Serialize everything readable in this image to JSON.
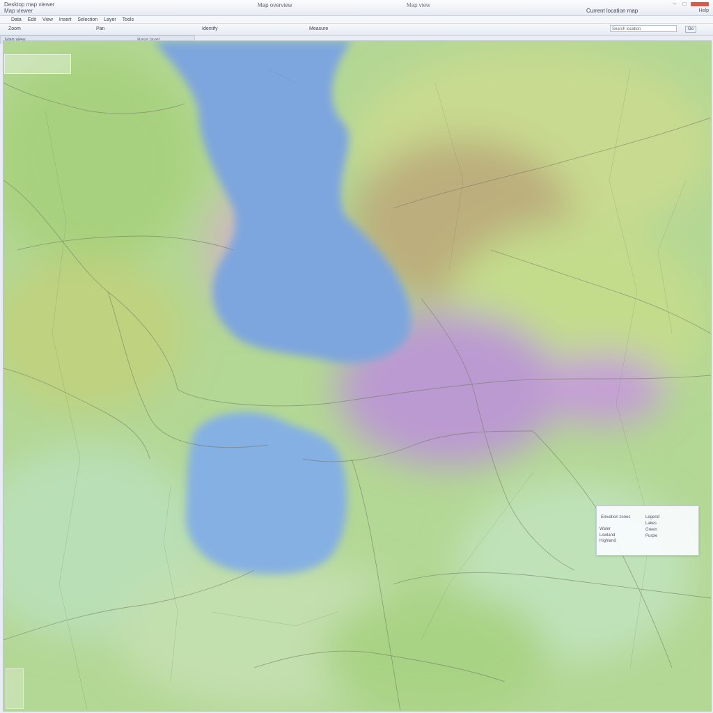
{
  "window": {
    "app_title": "Desktop map viewer",
    "subtitle": "Map viewer",
    "document_title": "Map overview",
    "center_label": "Map view",
    "account_label": "Current location map"
  },
  "menu": {
    "items": [
      "Data",
      "Edit",
      "View",
      "Insert",
      "Selection",
      "Layer",
      "Tools"
    ],
    "right_label": "Help"
  },
  "toolbar": {
    "items": [
      "Zoom",
      "Pan",
      "Identify",
      "Measure"
    ],
    "search_placeholder": "Search location",
    "search_button": "Go"
  },
  "tabs": [
    {
      "label": "Map view"
    },
    {
      "label": "Base layer"
    }
  ],
  "legend": {
    "title": "Elevation zones",
    "header_right": "Legend",
    "rows": [
      {
        "label": "Water",
        "value": "Lakes"
      },
      {
        "label": "Lowland",
        "value": "Green"
      },
      {
        "label": "Highland",
        "value": "Purple"
      }
    ]
  },
  "map": {
    "colors": {
      "water": "#7fa8df",
      "lowland": "#a9d38a",
      "meadow": "#c9dc94",
      "hill": "#b9b07f",
      "highland": "#b99ad0",
      "pale": "#b9dfb6",
      "roads": "#6d7560"
    }
  }
}
